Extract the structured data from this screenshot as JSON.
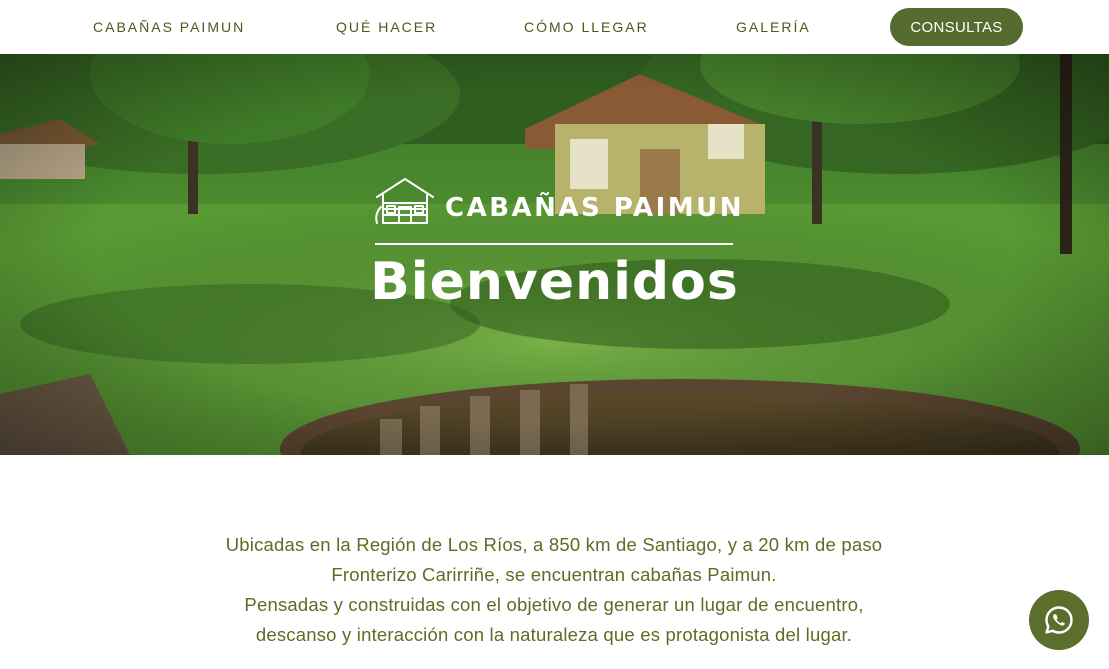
{
  "nav": {
    "links": [
      {
        "label": "CABAÑAS PAIMUN"
      },
      {
        "label": "QUÉ HACER"
      },
      {
        "label": "CÓMO LLEGAR"
      },
      {
        "label": "GALERÍA"
      }
    ],
    "cta_label": "CONSULTAS"
  },
  "hero": {
    "brand_icon": "cabin-icon",
    "brand_name": "CABAÑAS PAIMUN",
    "title": "Bienvenidos"
  },
  "intro": {
    "lines": [
      "Ubicadas en la Región de Los Ríos, a 850 km de Santiago, y a 20 km de paso",
      "Fronterizo Carirriñe, se encuentran cabañas Paimun.",
      "Pensadas y construidas con el objetivo de generar un lugar de encuentro,",
      "descanso y interacción con la naturaleza que es protagonista del lugar."
    ]
  },
  "whatsapp": {
    "icon": "whatsapp-icon"
  },
  "colors": {
    "accent": "#556b2f",
    "nav_text": "#4a5a1c",
    "body_text": "#5b6e25",
    "hero_text": "#ffffff"
  }
}
